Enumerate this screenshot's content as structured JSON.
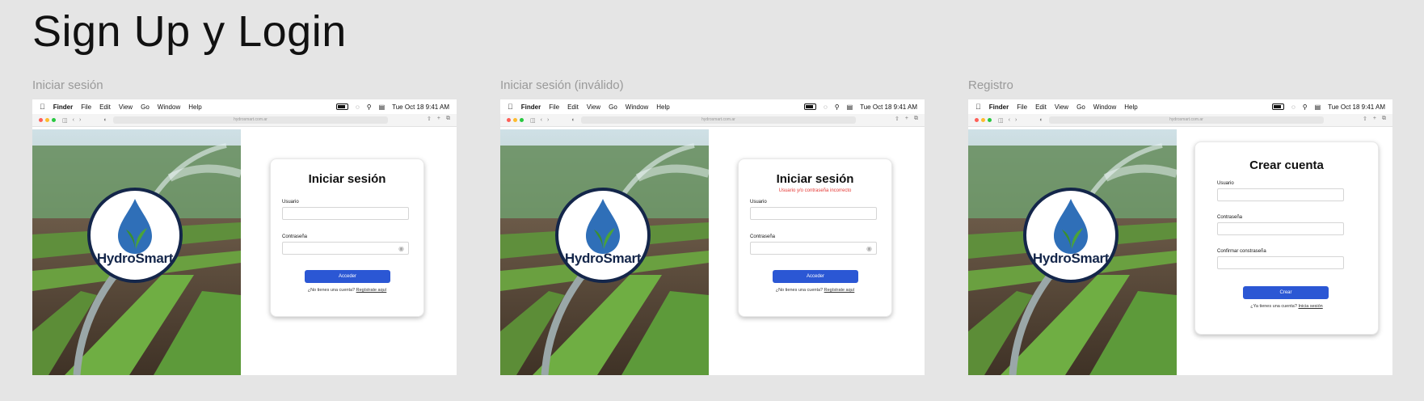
{
  "page": {
    "title": "Sign Up y Login"
  },
  "mac": {
    "menu_items": [
      "Finder",
      "File",
      "Edit",
      "View",
      "Go",
      "Window",
      "Help"
    ],
    "datetime": "Tue Oct 18  9:41 AM"
  },
  "brand": {
    "logo_text": "HydroSmart",
    "logo_color": "#14264a",
    "drop_color": "#2f6fb8",
    "leaf_color": "#3a8f2f",
    "accent": "#2b57d4",
    "error_color": "#e53935"
  },
  "frames": [
    {
      "label": "Iniciar sesión",
      "url": "hydrosmart.com.ar",
      "card": {
        "title": "Iniciar sesión",
        "error": "",
        "fields": [
          {
            "label": "Usuario",
            "value": ""
          },
          {
            "label": "Contraseña",
            "value": ""
          }
        ],
        "button": "Acceder",
        "footer_text": "¿No tienes una cuenta?",
        "footer_link": "Regístrate aquí"
      }
    },
    {
      "label": "Iniciar sesión (inválido)",
      "url": "hydrosmart.com.ar",
      "card": {
        "title": "Iniciar sesión",
        "error": "Usuario y/o contraseña incorrecto",
        "fields": [
          {
            "label": "Usuario",
            "value": ""
          },
          {
            "label": "Contraseña",
            "value": ""
          }
        ],
        "button": "Acceder",
        "footer_text": "¿No tienes una cuenta?",
        "footer_link": "Regístrate aquí"
      }
    },
    {
      "label": "Registro",
      "url": "hydrosmart.com.ar",
      "card": {
        "title": "Crear cuenta",
        "fields": [
          {
            "label": "Usuario",
            "value": ""
          },
          {
            "label": "Contraseña",
            "value": ""
          },
          {
            "label": "Confirmar constraseña",
            "value": ""
          }
        ],
        "button": "Crear",
        "footer_text": "¿Ya tienes una cuenta?",
        "footer_link": "Inicia sesión"
      }
    }
  ]
}
